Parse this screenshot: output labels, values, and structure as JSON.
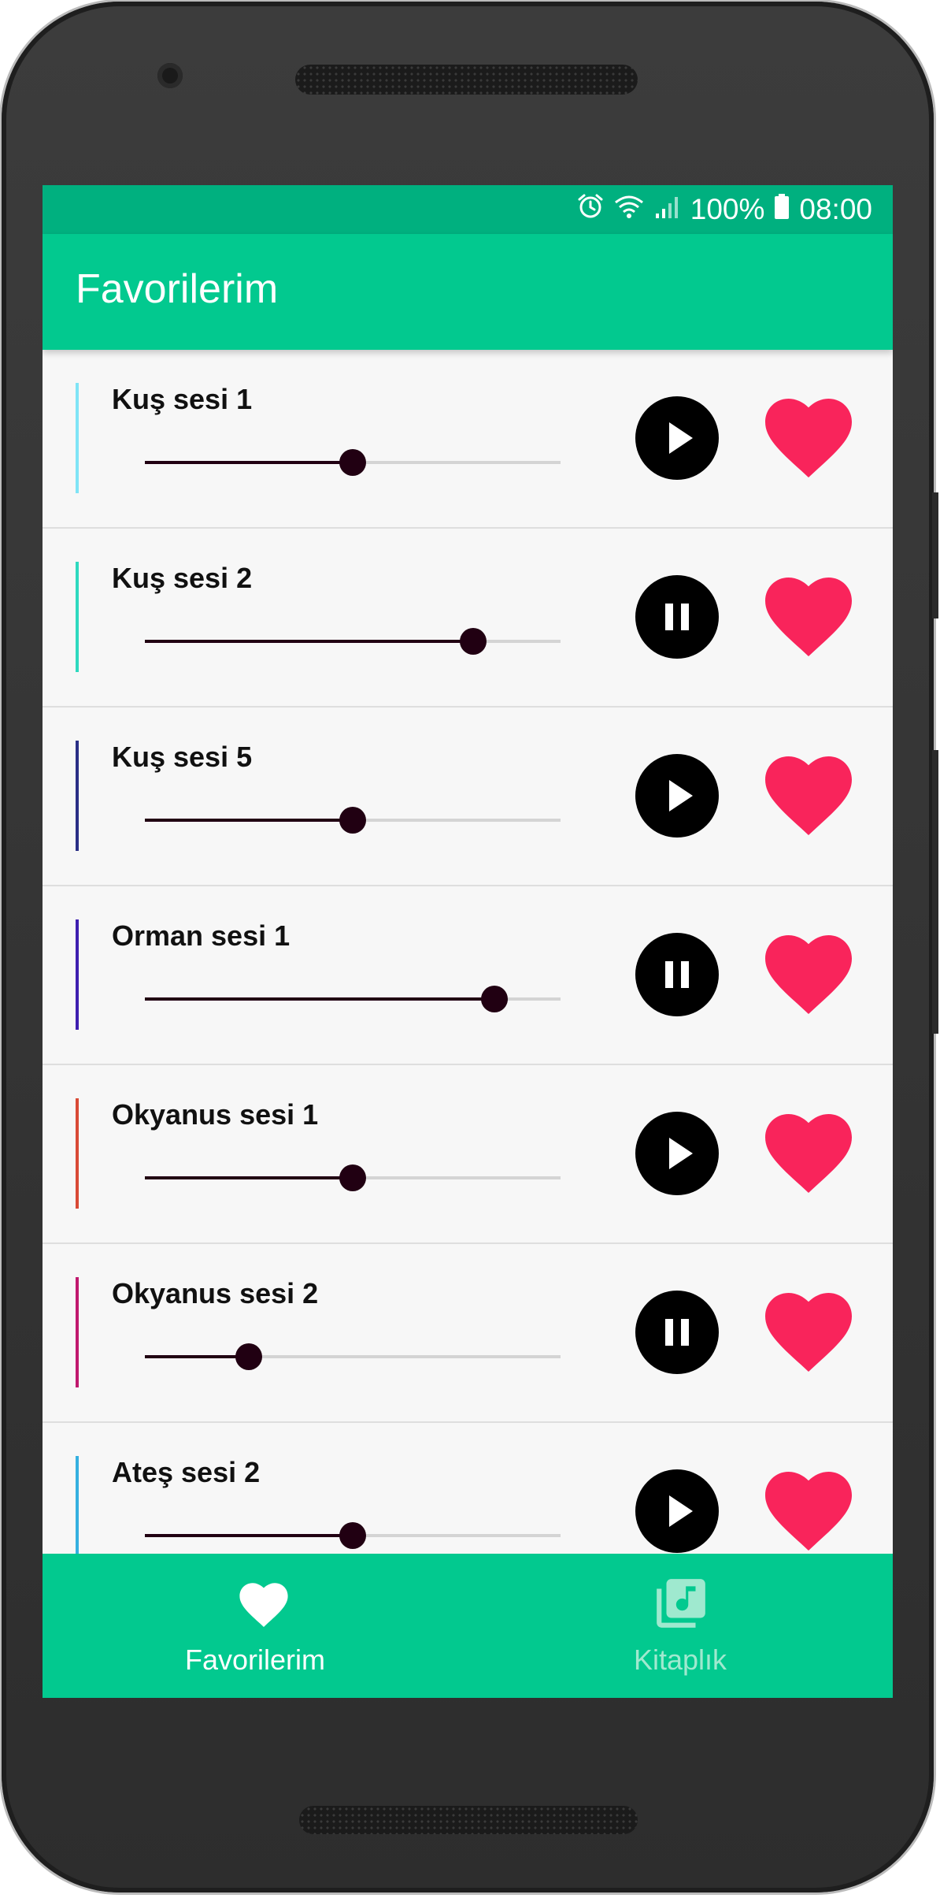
{
  "status_bar": {
    "battery": "100%",
    "time": "08:00",
    "icons": [
      "alarm-icon",
      "wifi-icon",
      "signal-icon",
      "battery-icon"
    ]
  },
  "app_bar": {
    "title": "Favorilerim"
  },
  "items": [
    {
      "title": "Kuş sesi 1",
      "accent": "#7fe4f6",
      "state": "paused",
      "action_icon": "play-icon",
      "progress": 0.5,
      "favorite": true
    },
    {
      "title": "Kuş sesi 2",
      "accent": "#2ed9bf",
      "state": "playing",
      "action_icon": "pause-icon",
      "progress": 0.79,
      "favorite": true
    },
    {
      "title": "Kuş sesi 5",
      "accent": "#2a2f86",
      "state": "paused",
      "action_icon": "play-icon",
      "progress": 0.5,
      "favorite": true
    },
    {
      "title": "Orman sesi 1",
      "accent": "#3f1fb0",
      "state": "playing",
      "action_icon": "pause-icon",
      "progress": 0.84,
      "favorite": true
    },
    {
      "title": "Okyanus sesi 1",
      "accent": "#d94a36",
      "state": "paused",
      "action_icon": "play-icon",
      "progress": 0.5,
      "favorite": true
    },
    {
      "title": "Okyanus sesi 2",
      "accent": "#c0196e",
      "state": "playing",
      "action_icon": "pause-icon",
      "progress": 0.25,
      "favorite": true
    },
    {
      "title": "Ateş sesi 2",
      "accent": "#35b0e0",
      "state": "paused",
      "action_icon": "play-icon",
      "progress": 0.5,
      "favorite": true
    }
  ],
  "bottom_nav": {
    "tabs": [
      {
        "label": "Favorilerim",
        "icon": "heart-icon",
        "active": true
      },
      {
        "label": "Kitaplık",
        "icon": "music-library-icon",
        "active": false
      }
    ]
  },
  "colors": {
    "primary": "#02c98f",
    "primary_dark": "#00b07f",
    "heart": "#f9245b",
    "seek_active": "#210012",
    "seek_inactive": "#d4d4d4",
    "nav_inactive": "#9fe9cf"
  }
}
